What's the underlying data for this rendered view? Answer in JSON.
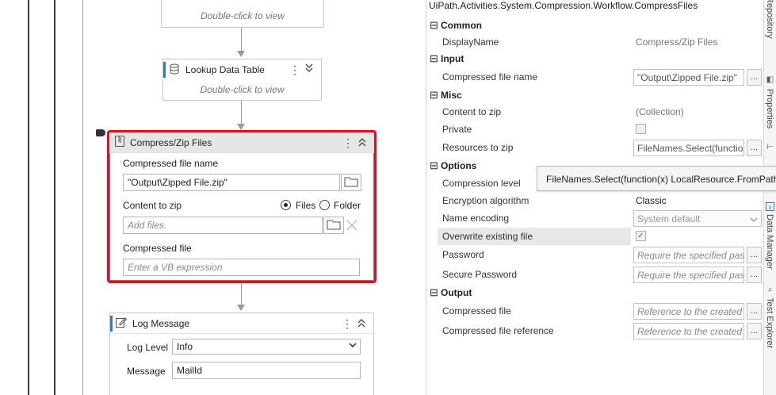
{
  "designer": {
    "prev_activity": {
      "hint": "Double-click to view"
    },
    "lookup": {
      "title": "Lookup Data Table",
      "hint": "Double-click to view"
    },
    "compress": {
      "title": "Compress/Zip Files",
      "compressed_file_name_label": "Compressed file name",
      "compressed_file_name_value": "\"Output\\Zipped File.zip\"",
      "content_label": "Content to zip",
      "radio_files": "Files",
      "radio_folder": "Folder",
      "files_placeholder": "Add files.",
      "compressed_file_label": "Compressed file",
      "compressed_file_placeholder": "Enter a VB expression"
    },
    "log": {
      "title": "Log Message",
      "level_label": "Log Level",
      "level_value": "Info",
      "message_label": "Message",
      "message_value": "MailId"
    }
  },
  "properties": {
    "type_name": "UiPath.Activities.System.Compression.Workflow.CompressFiles",
    "categories": {
      "common": "Common",
      "input": "Input",
      "misc": "Misc",
      "options": "Options",
      "output": "Output"
    },
    "rows": {
      "display_name": {
        "name": "DisplayName",
        "value": "Compress/Zip Files"
      },
      "compressed_file_name": {
        "name": "Compressed file name",
        "value": "\"Output\\Zipped File.zip\""
      },
      "content_to_zip": {
        "name": "Content to zip",
        "value": "(Collection)"
      },
      "private": {
        "name": "Private"
      },
      "resources_to_zip": {
        "name": "Resources to zip",
        "value": "FileNames.Select(function(x) LocalResource.FromPath(x))"
      },
      "compression_level": {
        "name": "Compression level"
      },
      "encryption_algorithm": {
        "name": "Encryption algorithm",
        "value": "Classic"
      },
      "name_encoding": {
        "name": "Name encoding",
        "value": "System default"
      },
      "overwrite_existing_file": {
        "name": "Overwrite existing file"
      },
      "password": {
        "name": "Password",
        "placeholder": "Require the specified password"
      },
      "secure_password": {
        "name": "Secure Password",
        "placeholder": "Require the specified password"
      },
      "compressed_file": {
        "name": "Compressed file",
        "placeholder": "Reference to the created file"
      },
      "compressed_file_reference": {
        "name": "Compressed file reference",
        "placeholder": "Reference to the created file"
      }
    },
    "dots": "...",
    "tooltip": "FileNames.Select(function(x) LocalResource.FromPath(x))"
  },
  "side_tabs": [
    "Repository",
    "Properties",
    "Data Manager",
    "Test Explorer"
  ],
  "colors": {
    "selection_border": "#e0101c",
    "selection_inner": "#6f6fd8"
  }
}
